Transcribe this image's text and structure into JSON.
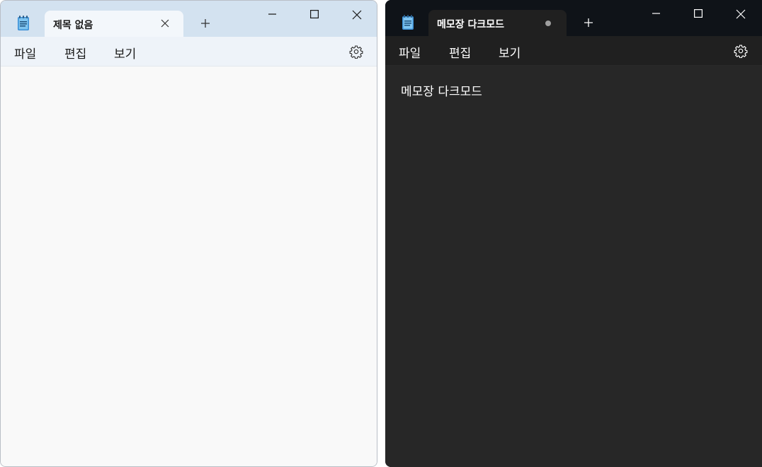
{
  "light_window": {
    "tab_title": "제목 없음",
    "menu": [
      "파일",
      "편집",
      "보기"
    ],
    "icons": {
      "app": "notepad-icon",
      "tab_close": "close-icon",
      "new_tab": "plus-icon",
      "minimize": "minimize-icon",
      "maximize": "maximize-icon",
      "close": "close-icon",
      "settings": "gear-icon"
    },
    "colors": {
      "titlebar": "#d3e2f0",
      "menubar": "#eef3f9",
      "editor": "#f9f9f9"
    }
  },
  "dark_window": {
    "tab_title": "메모장 다크모드",
    "menu": [
      "파일",
      "편집",
      "보기"
    ],
    "editor_content": "메모장 다크모드",
    "icons": {
      "app": "notepad-icon",
      "unsaved": "unsaved-dot-icon",
      "new_tab": "plus-icon",
      "minimize": "minimize-icon",
      "maximize": "maximize-icon",
      "close": "close-icon",
      "settings": "gear-icon"
    },
    "colors": {
      "titlebar": "#0f1318",
      "menubar": "#202020",
      "editor": "#272727"
    }
  }
}
